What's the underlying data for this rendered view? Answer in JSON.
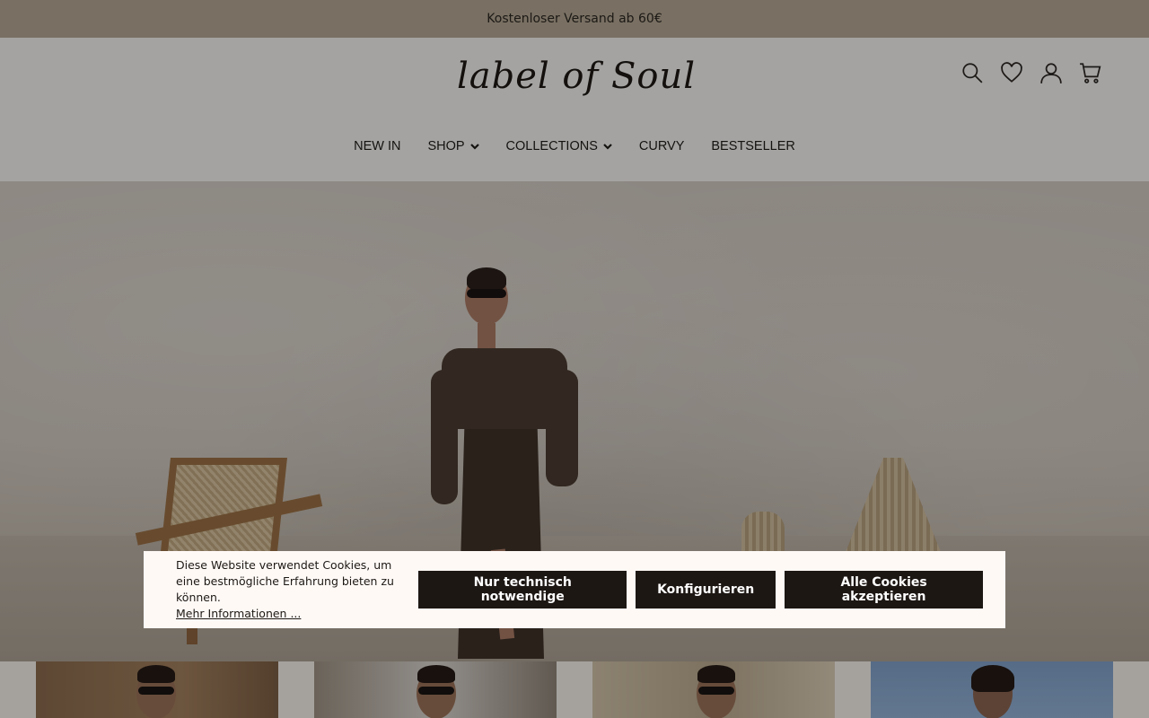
{
  "topbar": {
    "message": "Kostenloser Versand ab 60€"
  },
  "header": {
    "logo_text": "label of Soul",
    "icons": [
      "search-icon",
      "heart-icon",
      "user-icon",
      "cart-icon"
    ]
  },
  "nav": {
    "items": [
      {
        "label": "NEW IN",
        "dropdown": false
      },
      {
        "label": "SHOP",
        "dropdown": true
      },
      {
        "label": "COLLECTIONS",
        "dropdown": true
      },
      {
        "label": "CURVY",
        "dropdown": false
      },
      {
        "label": "BESTSELLER",
        "dropdown": false
      }
    ]
  },
  "cookie": {
    "text": "Diese Website verwendet Cookies, um eine bestmögliche Erfahrung bieten zu können.",
    "link": "Mehr Informationen ...",
    "buttons": {
      "necessary": "Nur technisch notwendige",
      "configure": "Konfigurieren",
      "accept_all": "Alle Cookies akzeptieren"
    }
  },
  "colors": {
    "topbar_bg": "#b3a592",
    "header_bg": "#f3f1ee",
    "button_bg": "#1d1714",
    "cookie_bg": "#fff9f6"
  }
}
